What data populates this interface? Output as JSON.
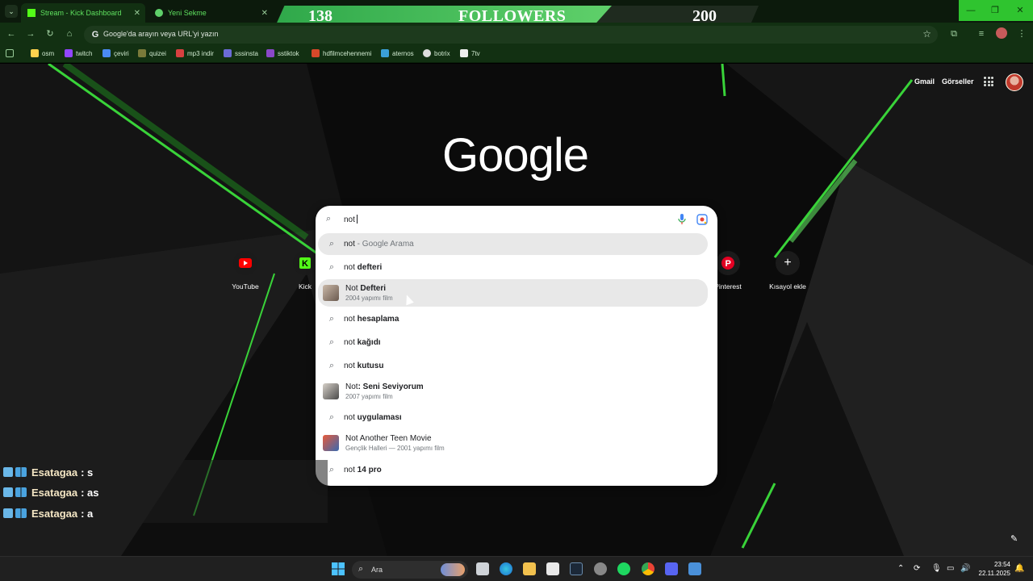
{
  "tabs": [
    {
      "title": "Stream - Kick Dashboard",
      "active": true
    },
    {
      "title": "Yeni Sekme",
      "active": false
    }
  ],
  "followers_widget": {
    "current": "138",
    "label": "FOLLOWERS",
    "goal": "200",
    "progress": 0.69
  },
  "omnibox": {
    "placeholder": "Google'da arayın veya URL'yi yazın"
  },
  "bookmarks": [
    "osm",
    "twitch",
    "çeviri",
    "quizei",
    "mp3 indir",
    "sssinsta",
    "sstiktok",
    "hdfilmcehennemi",
    "aternos",
    "botrix",
    "7tv"
  ],
  "ntp": {
    "links": {
      "gmail": "Gmail",
      "images": "Görseller"
    },
    "logo": "Google",
    "shortcuts": [
      {
        "label": "YouTube",
        "icon": "youtube-icon"
      },
      {
        "label": "Kick",
        "icon": "kick-icon"
      },
      {
        "label": "Pinterest",
        "icon": "pinterest-icon"
      },
      {
        "label": "Kısayol ekle",
        "icon": "plus-icon"
      }
    ]
  },
  "search": {
    "query": "not",
    "suggestions": [
      {
        "prefix": "not",
        "rest": " - Google Arama",
        "sub": "",
        "kind": "search",
        "highlight": true
      },
      {
        "prefix": "not",
        "rest": " defteri",
        "sub": "",
        "kind": "search"
      },
      {
        "prefix": "Not",
        "rest": " Defteri",
        "sub": "2004 yapımı film",
        "kind": "entity",
        "highlight": true
      },
      {
        "prefix": "not",
        "rest": " hesaplama",
        "sub": "",
        "kind": "search"
      },
      {
        "prefix": "not",
        "rest": " kağıdı",
        "sub": "",
        "kind": "search"
      },
      {
        "prefix": "not",
        "rest": " kutusu",
        "sub": "",
        "kind": "search"
      },
      {
        "prefix": "Not",
        "rest": ": Seni Seviyorum",
        "sub": "2007 yapımı film",
        "kind": "entity"
      },
      {
        "prefix": "not",
        "rest": " uygulaması",
        "sub": "",
        "kind": "search"
      },
      {
        "prefix": "Not",
        "rest": " Another Teen Movie",
        "sub": "Gençlik Halleri — 2001 yapımı film",
        "kind": "entity"
      },
      {
        "prefix": "not",
        "rest": " 14 pro",
        "sub": "",
        "kind": "search"
      }
    ]
  },
  "chat": [
    {
      "user": "Esatagaa",
      "msg": ": s"
    },
    {
      "user": "Esatagaa",
      "msg": ": as"
    },
    {
      "user": "Esatagaa",
      "msg": ": a"
    }
  ],
  "taskbar": {
    "search_label": "Ara",
    "time": "23:54",
    "date": "22.11.2025"
  },
  "colors": {
    "accent": "#2fc42f",
    "dark_green": "#123012"
  }
}
